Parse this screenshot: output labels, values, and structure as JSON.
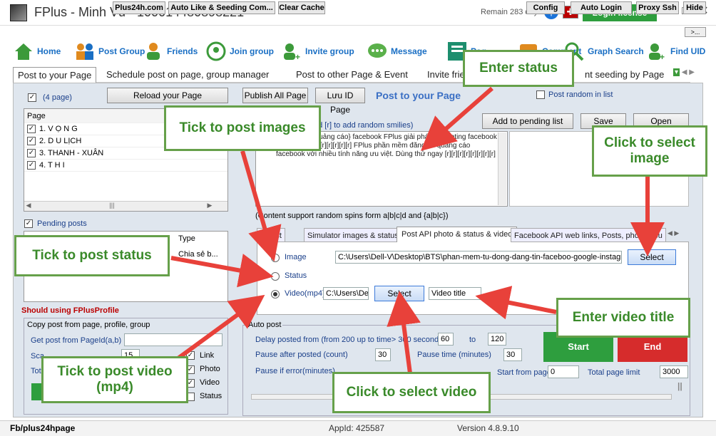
{
  "window": {
    "title": "FPlus - Minh Vũ - 100014480898221",
    "remain": "Remain 283 days",
    "login_license": "Login license",
    "more": ">..."
  },
  "nav": [
    {
      "label": "Home"
    },
    {
      "label": "Post Group"
    },
    {
      "label": "Friends"
    },
    {
      "label": "Join group"
    },
    {
      "label": "Invite group"
    },
    {
      "label": "Message"
    },
    {
      "label": "Pag"
    },
    {
      "label": "Comment"
    },
    {
      "label": "Graph Search"
    },
    {
      "label": "Find UID"
    }
  ],
  "tabs": [
    "Post to your Page",
    "Schedule post on page, group manager",
    "Post to other Page & Event",
    "Invite frie",
    "nt seeding by Page"
  ],
  "left": {
    "page_count": "(4 page)",
    "reload": "Reload your Page",
    "page_col": "Page",
    "pages": [
      "1. V Ọ N G",
      "2. D U LỊCH",
      "3. THANH - XUÂN",
      "4. T H I"
    ],
    "pending": "Pending posts",
    "type_col": "Type",
    "type_val": "Chia sẻ b...",
    "should": "Should using FPlusProfile",
    "copy_title": "Copy post from page, profile, group",
    "get_post": "Get post from PageId(a,b)",
    "sca": "Sca",
    "tot": "Tot",
    "sca_val": "15",
    "opts": [
      "Link",
      "Photo",
      "Video",
      "Status"
    ]
  },
  "center": {
    "publish_all": "Publish All Page",
    "luu_id": "Lưu ID Page",
    "heading": "Post to your Page",
    "random": "Post random in list",
    "hint_add": "dd [r] to add random smilies)",
    "add_pending": "Add to pending list",
    "save": "Save",
    "open": "Open",
    "content": "{tin|đăng tin|quảng cáo} facebook FPlus giải pháp marketing facebook hiệu quả. [r][r][r][r][r][r][r] FPlus phần mềm đăng tin quảng cáo facebook với nhiều tính năng ưu việt. Dùng thử ngay [r][r][r][r][r][r][r][r]",
    "content_hint": "(Content support random spins form a|b|c|d and {a|b|c})",
    "subtabs": [
      "e post",
      "Simulator images & status",
      "Post API photo & status & video",
      "Facebook API web links, Posts, photo albu"
    ],
    "image": "Image",
    "image_path": "C:\\Users\\Dell-V\\Desktop\\BTS\\phan-mem-tu-dong-dang-tin-faceboo-google-instagra",
    "select": "Select",
    "status": "Status",
    "video": "Video(mp4)",
    "video_path": "C:\\Users\\De",
    "video_title": "Video title"
  },
  "autopost": {
    "title": "Auto post",
    "delay": "Delay posted from (from 200 up to time> 300 seconds)",
    "delay_from": "60",
    "to": "to",
    "delay_to": "120",
    "pause_after": "Pause after posted (count)",
    "pause_after_val": "30",
    "pause_time": "Pause time (minutes)",
    "pause_time_val": "30",
    "pause_error": "Pause if error(minutes)",
    "start_from": "Start from page",
    "start_from_val": "0",
    "total_limit": "Total page limit",
    "total_limit_val": "3000",
    "start": "Start",
    "end": "End"
  },
  "callouts": {
    "enter_status": "Enter status",
    "tick_images": "Tick to post images",
    "click_image": "Click to select image",
    "tick_status": "Tick to post status",
    "enter_video_title": "Enter video title",
    "tick_video": "Tick to post video (mp4)",
    "click_video": "Click to select video"
  },
  "statusbar": {
    "fb": "Fb/plus24hpage",
    "plus24h": "Plus24h.com",
    "autolike": "Auto Like & Seeding Com...",
    "clear": "Clear Cache",
    "appid": "AppId: 425587",
    "version": "Version 4.8.9.10",
    "config": "Config",
    "autologin": "Auto Login",
    "proxy": "Proxy Ssh",
    "hide": "Hide"
  },
  "colors": {
    "accent_green": "#2e9e3e",
    "end_red": "#d62c2c",
    "callout_border": "#66a04a",
    "arrow": "#e8413a",
    "nav_blue": "#1a6fc4"
  }
}
